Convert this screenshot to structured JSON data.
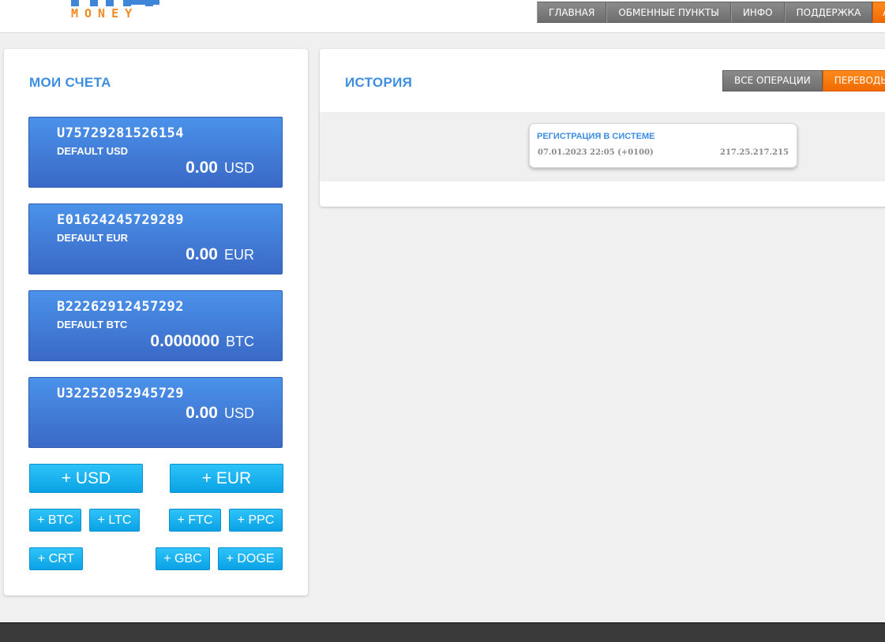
{
  "logo": {
    "text": "MONEY"
  },
  "nav": {
    "items": [
      "ГЛАВНАЯ",
      "ОБМЕННЫЕ ПУНКТЫ",
      "ИНФО",
      "ПОДДЕРЖКА",
      "А"
    ]
  },
  "accounts": {
    "title": "МОИ СЧЕТА",
    "list": [
      {
        "number": "U75729281526154",
        "name": "DEFAULT USD",
        "amount": "0.00",
        "currency": "USD"
      },
      {
        "number": "E01624245729289",
        "name": "DEFAULT EUR",
        "amount": "0.00",
        "currency": "EUR"
      },
      {
        "number": "B22262912457292",
        "name": "DEFAULT BTC",
        "amount": "0.000000",
        "currency": "BTC"
      },
      {
        "number": "U32252052945729",
        "name": "",
        "amount": "0.00",
        "currency": "USD"
      }
    ],
    "add_buttons": {
      "usd": "+ USD",
      "eur": "+ EUR",
      "btc": "+ BTC",
      "ltc": "+ LTC",
      "ftc": "+ FTC",
      "ppc": "+ PPC",
      "crt": "+ CRT",
      "gbc": "+ GBC",
      "doge": "+ DOGE"
    }
  },
  "history": {
    "title": "ИСТОРИЯ",
    "tabs": [
      "ВСЕ ОПЕРАЦИИ",
      "ПЕРЕВОДЫ"
    ],
    "entries": [
      {
        "title": "РЕГИСТРАЦИЯ В СИСТЕМЕ",
        "datetime": "07.01.2023 22:05 (+0100)",
        "ip": "217.25.217.215"
      }
    ]
  },
  "colors": {
    "accent_blue": "#3d8ee0",
    "card_blue": "#3a69c6",
    "button_cyan": "#0aa2e6",
    "nav_orange": "#f06a00",
    "nav_gray": "#6e6e6e",
    "logo_orange": "#f08a24"
  }
}
